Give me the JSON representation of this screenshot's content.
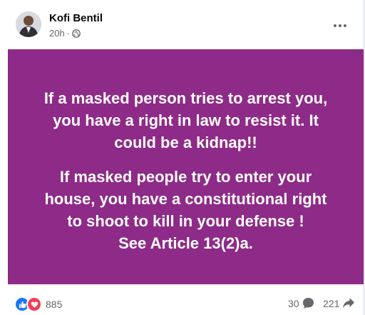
{
  "post": {
    "author": "Kofi Bentil",
    "time": "20h",
    "meta_separator": "·",
    "audience_icon": "globe-icon",
    "background_color": "#8e2a87",
    "paragraph1": [
      "If a masked person tries to arrest you,",
      "you have a right in law to resist it. It",
      "could be a kidnap!!"
    ],
    "paragraph2": [
      "If masked people try to enter your",
      "house, you have a constitutional right",
      "to shoot to kill in your defense !",
      "See Article 13(2)a."
    ]
  },
  "footer": {
    "reactions": [
      "like-icon",
      "love-icon"
    ],
    "reaction_count": "885",
    "comment_count": "30",
    "share_count": "221"
  },
  "colors": {
    "like": "#1877f2",
    "love": "#f33e58",
    "secondary_text": "#65676b"
  }
}
